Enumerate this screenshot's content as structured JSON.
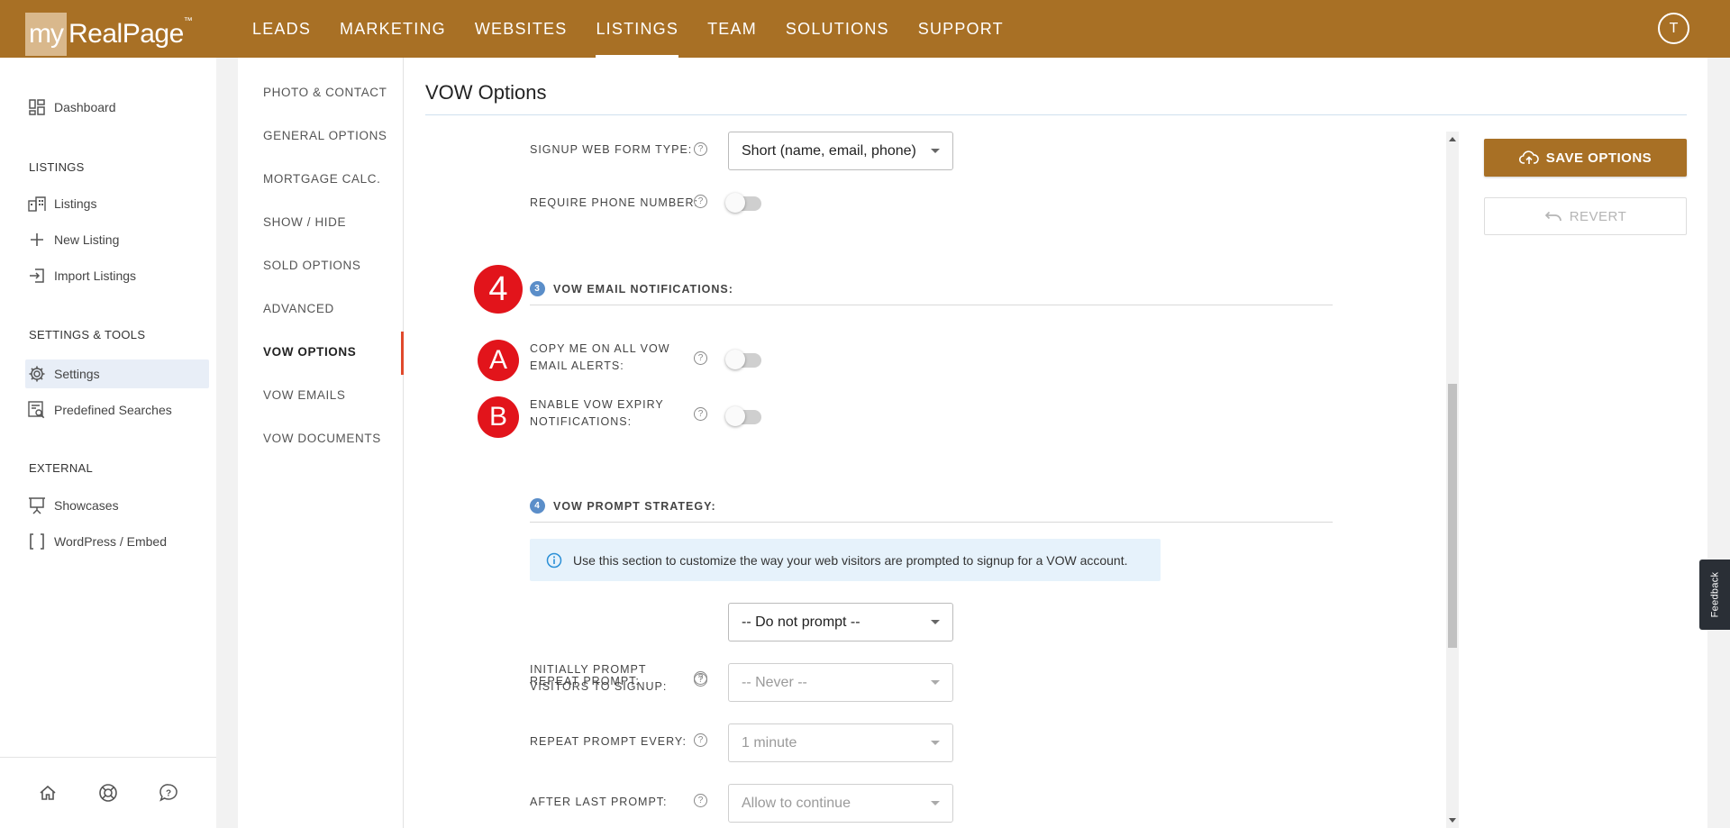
{
  "brand": {
    "my": "my",
    "name": "RealPage",
    "tm": "™"
  },
  "top_nav": [
    "LEADS",
    "MARKETING",
    "WEBSITES",
    "LISTINGS",
    "TEAM",
    "SOLUTIONS",
    "SUPPORT"
  ],
  "user_initial": "T",
  "sidebar": {
    "dashboard": "Dashboard",
    "listings_section": "LISTINGS",
    "listings": "Listings",
    "new_listing": "New Listing",
    "import_listings": "Import Listings",
    "settings_section": "SETTINGS & TOOLS",
    "settings": "Settings",
    "predefined_searches": "Predefined Searches",
    "external_section": "EXTERNAL",
    "showcases": "Showcases",
    "wordpress": "WordPress / Embed"
  },
  "subnav": [
    "PHOTO & CONTACT",
    "GENERAL OPTIONS",
    "MORTGAGE CALC.",
    "SHOW / HIDE",
    "SOLD OPTIONS",
    "ADVANCED",
    "VOW OPTIONS",
    "VOW EMAILS",
    "VOW DOCUMENTS"
  ],
  "page_title": "VOW Options",
  "form": {
    "signup_type_label": "SIGNUP WEB FORM TYPE:",
    "signup_type_value": "Short (name, email, phone)",
    "require_phone_label": "REQUIRE PHONE NUMBER:",
    "section3_num": "3",
    "section3_title": "VOW EMAIL NOTIFICATIONS:",
    "copy_me_label_1": "COPY ME ON ALL VOW",
    "copy_me_label_2": "EMAIL ALERTS:",
    "expiry_label_1": "ENABLE VOW EXPIRY",
    "expiry_label_2": "NOTIFICATIONS:",
    "section4_num": "4",
    "section4_title": "VOW PROMPT STRATEGY:",
    "info_text": "Use this section to customize the way your web visitors are prompted to signup for a VOW account.",
    "initial_prompt_label_1": "INITIALLY PROMPT",
    "initial_prompt_label_2": "VISITORS TO SIGNUP:",
    "initial_prompt_value": "-- Do not prompt --",
    "repeat_prompt_label": "REPEAT PROMPT:",
    "repeat_prompt_value": "-- Never --",
    "repeat_every_label": "REPEAT PROMPT EVERY:",
    "repeat_every_value": "1 minute",
    "after_last_label": "AFTER LAST PROMPT:",
    "after_last_value": "Allow to continue",
    "require_phone_on": false,
    "copy_me_on": false,
    "expiry_on": false
  },
  "markers": {
    "step": "4",
    "a": "A",
    "b": "B"
  },
  "buttons": {
    "save": "SAVE OPTIONS",
    "revert": "REVERT"
  },
  "feedback": "Feedback",
  "colors": {
    "brand": "#a87025",
    "marker": "#e2141b",
    "section_num": "#5b8ec9",
    "active_tab": "#e0492c"
  }
}
